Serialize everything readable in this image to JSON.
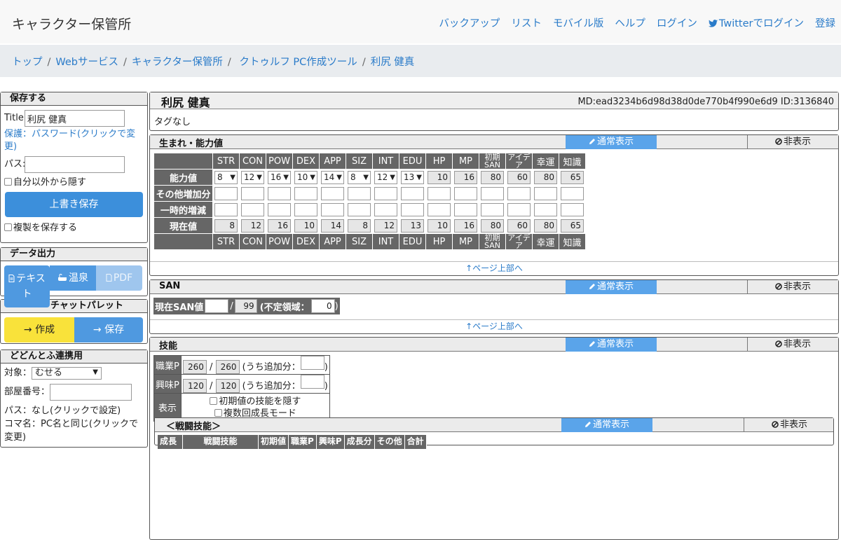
{
  "navbar": {
    "brand": "キャラクター保管所",
    "links": [
      "バックアップ",
      "リスト",
      "モバイル版",
      "ヘルプ",
      "ログイン",
      "Twitterでログイン",
      "登録"
    ]
  },
  "breadcrumb": [
    "トップ",
    "Webサービス",
    "キャラクター保管所",
    " クトゥルフ PC作成ツール",
    "利尻 健真"
  ],
  "save_box": {
    "header": "保存する",
    "title_label": "Title:",
    "title_value": "利尻 健真",
    "protect_link": "保護：パスワード(クリックで変更)",
    "pass_label": "パス:",
    "hide_label": "自分以外から隠す",
    "overwrite_button": "上書き保存",
    "copy_label": "複製を保存する"
  },
  "export_box": {
    "header": "データ出力",
    "text_button": "テキスト",
    "onsen_button": "温泉",
    "pdf_button": "PDF"
  },
  "chat_box": {
    "header": "チャットパレット",
    "create_button": "→ 作成",
    "save_button": "→ 保存"
  },
  "dodontof_box": {
    "header": "どどんとふ連携用",
    "target_label": "対象：",
    "target_value": "むせる",
    "room_label": "部屋番号：",
    "pass_text": "パス：なし(クリックで設定)",
    "koma_text": "コマ名：PC名と同じ(クリックで変更)"
  },
  "character": {
    "name": "利尻 健真",
    "meta": "MD:ead3234b6d98d38d0de770b4f990e6d9   ID:3136840",
    "tags": "タグなし"
  },
  "panel_controls": {
    "normal_label": "通常表示",
    "hide_label": "非表示",
    "page_top": "↑ページ上部へ"
  },
  "abilities": {
    "title": "生まれ・能力値",
    "columns": [
      "STR",
      "CON",
      "POW",
      "DEX",
      "APP",
      "SIZ",
      "INT",
      "EDU",
      "HP",
      "MP",
      "初期SAN",
      "アイデア",
      "幸運",
      "知識"
    ],
    "row_labels": [
      "能力値",
      "その他増加分",
      "一時的増減",
      "現在値"
    ],
    "base": [
      "8",
      "12",
      "16",
      "10",
      "14",
      "8",
      "12",
      "13",
      "10",
      "16",
      "80",
      "60",
      "80",
      "65"
    ],
    "current": [
      "8",
      "12",
      "16",
      "10",
      "14",
      "8",
      "12",
      "13",
      "10",
      "16",
      "80",
      "60",
      "80",
      "65"
    ]
  },
  "san": {
    "title": "SAN",
    "current_label": "現在SAN値",
    "max": "99",
    "indef_label": "(不定領域：",
    "indef_value": "0"
  },
  "skills": {
    "title": "技能",
    "job_label": "職業P",
    "job_spent": "260",
    "job_total": "260",
    "hobby_label": "興味P",
    "hobby_spent": "120",
    "hobby_total": "120",
    "extra_label": "(うち追加分：",
    "display_label": "表示",
    "hide_initial": "初期値の技能を隠す",
    "multi_growth": "複数回成長モード",
    "combat_title": "＜戦闘技能＞",
    "combat_columns": [
      "成長",
      "戦闘技能",
      "初期値",
      "職業P",
      "興味P",
      "成長分",
      "その他",
      "合計"
    ]
  }
}
